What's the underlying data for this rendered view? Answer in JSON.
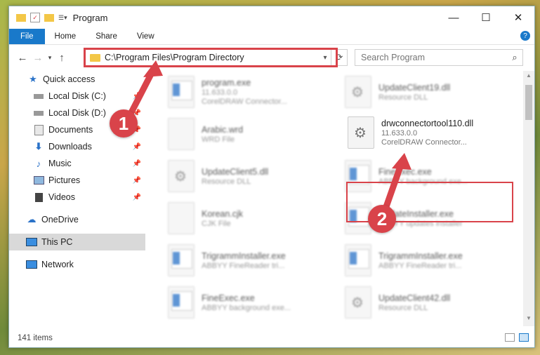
{
  "window": {
    "title": "Program",
    "controls": {
      "minimize": "—",
      "maximize": "☐",
      "close": "✕"
    }
  },
  "ribbon": {
    "tabs": [
      "File",
      "Home",
      "Share",
      "View"
    ],
    "help": "?"
  },
  "nav": {
    "address": "C:\\Program Files\\Program Directory",
    "search_placeholder": "Search Program"
  },
  "sidebar": {
    "items": [
      {
        "label": "Quick access",
        "icon": "star-icon"
      },
      {
        "label": "Local Disk (C:)",
        "icon": "drive-icon"
      },
      {
        "label": "Local Disk (D:)",
        "icon": "drive-icon"
      },
      {
        "label": "Documents",
        "icon": "documents-icon"
      },
      {
        "label": "Downloads",
        "icon": "download-icon"
      },
      {
        "label": "Music",
        "icon": "music-icon"
      },
      {
        "label": "Pictures",
        "icon": "pictures-icon"
      },
      {
        "label": "Videos",
        "icon": "videos-icon"
      },
      {
        "label": "OneDrive",
        "icon": "cloud-icon"
      },
      {
        "label": "This PC",
        "icon": "computer-icon"
      },
      {
        "label": "Network",
        "icon": "network-icon"
      }
    ]
  },
  "files": {
    "left": [
      {
        "name": "program.exe",
        "sub": "11.633.0.0",
        "sub2": "CorelDRAW Connector..."
      },
      {
        "name": "Arabic.wrd",
        "sub": "WRD File"
      },
      {
        "name": "UpdateClient5.dll",
        "sub": "Resource DLL"
      },
      {
        "name": "Korean.cjk",
        "sub": "CJK File"
      },
      {
        "name": "TrigrammInstaller.exe",
        "sub": "ABBYY FineReader tri..."
      },
      {
        "name": "FineExec.exe",
        "sub": "ABBYY background exe..."
      }
    ],
    "right": [
      {
        "name": "UpdateClient19.dll",
        "sub": "Resource DLL"
      },
      {
        "name": "drwconnectortool110.dll",
        "sub": "11.633.0.0",
        "sub2": "CorelDRAW Connector..."
      },
      {
        "name": "FineExec.exe",
        "sub": "ABBYY background exe..."
      },
      {
        "name": "UpdateInstaller.exe",
        "sub": "ABBYY updates installer"
      },
      {
        "name": "TrigrammInstaller.exe",
        "sub": "ABBYY FineReader tri..."
      },
      {
        "name": "UpdateClient42.dll",
        "sub": "Resource DLL"
      }
    ]
  },
  "status": {
    "count": "141 items"
  },
  "annotations": {
    "step1": "1",
    "step2": "2",
    "color": "#d9434a"
  }
}
